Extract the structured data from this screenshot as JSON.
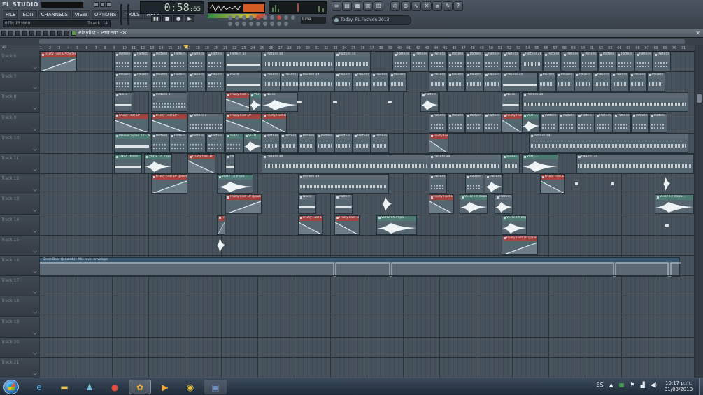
{
  "app": {
    "logo_text": "FL STUDIO",
    "menu": [
      "FILE",
      "EDIT",
      "CHANNELS",
      "VIEW",
      "OPTIONS",
      "TOOLS",
      "HELP"
    ],
    "hint_text": "070:15:000",
    "hint_right": "Track 14",
    "time_main": "0:58",
    "time_small": ":65",
    "line_label": "Line",
    "news_text": "Today: FL.Fashion 2013"
  },
  "playlist": {
    "title": "Playlist - Pattern 38",
    "ruler_left": "All",
    "ruler_numbers": [
      "1",
      "2",
      "3",
      "4",
      "5",
      "6",
      "7",
      "8",
      "9",
      "10",
      "11",
      "12",
      "13",
      "14",
      "15",
      "16",
      "17",
      "18",
      "19",
      "20",
      "21",
      "22",
      "23",
      "24",
      "25",
      "26",
      "27",
      "28",
      "29",
      "30",
      "31",
      "32",
      "33",
      "34",
      "35",
      "36",
      "37",
      "38",
      "39",
      "40",
      "41",
      "42",
      "43",
      "44",
      "45",
      "46",
      "47",
      "48",
      "49",
      "50",
      "51",
      "52",
      "53",
      "54",
      "55",
      "56",
      "57",
      "58",
      "59",
      "60",
      "61",
      "62",
      "63",
      "64",
      "65",
      "66",
      "67",
      "68",
      "69",
      "70",
      "71"
    ],
    "tracks": [
      "Track 6",
      "Track 7",
      "Track 8",
      "Track 9",
      "Track 10",
      "Track 11",
      "Track 12",
      "Track 13",
      "Track 14",
      "Track 15",
      "Track 16",
      "Track 17",
      "Track 18",
      "Track 19",
      "Track 20",
      "Track 21"
    ],
    "envelope_label": "Gross Beat (Jonaroh) - Mix level envelope",
    "clip_labels": {
      "fruity_fast": "Fruity Fast LP (Sylenth...",
      "fruity_fast_short": "Fruity Fast LP",
      "fruity_fast_jonaroh": "Fruity Fast LP (Jonaroh)",
      "pattern5": "Pattern 5",
      "pattern6": "Pattern 6",
      "pattern7": "Pattern 7",
      "pattern8": "Pattern 8",
      "pattern14": "Pattern 14",
      "pattern19": "Pattern 19",
      "pattern20": "Pattern 20",
      "pattern21": "Pattern 21",
      "pattern23": "Pattern 23",
      "pattern24": "Pattern 24",
      "pattern25": "Pattern 25",
      "pattern26": "Pattern 26",
      "pattern27": "Pattern 27",
      "pattern28": "Pattern 28",
      "pattern29": "Pattern 29",
      "pattern30": "Pattern 30",
      "noise": "Noise",
      "vehicle": "VEH1...",
      "vehicle2": "VEH2 FX Impa...",
      "mellow": "Mellow Sylen 11 - Nob...",
      "sidechain": "..wFX Hexes - Th...",
      "sidech2": "SuDu..."
    }
  },
  "taskbar": {
    "lang": "ES",
    "time": "10:17 p.m.",
    "date": "31/03/2013"
  },
  "colors": {
    "grid_bg": "#46525c",
    "clip_bg": "#566670",
    "auto_label": "#a3433f",
    "fx_label": "#4d7a72"
  }
}
